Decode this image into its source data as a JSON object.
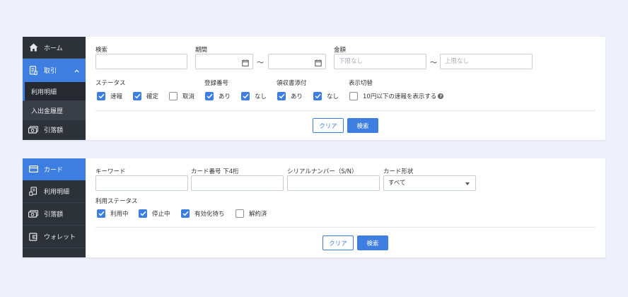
{
  "sidebar1": {
    "items": [
      {
        "label": "ホーム",
        "icon": "home-icon"
      },
      {
        "label": "取引",
        "icon": "receipt-icon",
        "active": true
      },
      {
        "label": "利用明細",
        "sub": true,
        "current": true
      },
      {
        "label": "入出金履歴",
        "sub": true
      },
      {
        "label": "引落額",
        "icon": "money-icon"
      }
    ]
  },
  "filter1": {
    "search_label": "検索",
    "period_label": "期間",
    "period_tilde": "～",
    "amount_label": "金額",
    "amount_min_placeholder": "下限なし",
    "amount_tilde": "～",
    "amount_max_placeholder": "上限なし",
    "status_label": "ステータス",
    "status_options": [
      {
        "label": "速報",
        "checked": true
      },
      {
        "label": "確定",
        "checked": true
      },
      {
        "label": "取消",
        "checked": false
      }
    ],
    "registration_label": "登録番号",
    "registration_options": [
      {
        "label": "あり",
        "checked": true
      },
      {
        "label": "なし",
        "checked": true
      }
    ],
    "receipt_label": "領収書添付",
    "receipt_options": [
      {
        "label": "あり",
        "checked": true
      },
      {
        "label": "なし",
        "checked": true
      }
    ],
    "display_label": "表示切替",
    "display_option": {
      "label": "10円以下の速報を表示する",
      "checked": false
    },
    "help_glyph": "?",
    "clear_label": "クリア",
    "search_button_label": "検索"
  },
  "sidebar2": {
    "items": [
      {
        "label": "カード",
        "icon": "card-icon",
        "active": true
      },
      {
        "label": "利用明細",
        "icon": "statement-icon"
      },
      {
        "label": "引落額",
        "icon": "money-icon"
      },
      {
        "label": "ウォレット",
        "icon": "wallet-icon"
      }
    ]
  },
  "filter2": {
    "keyword_label": "キーワード",
    "card_number_label": "カード番号 下4桁",
    "serial_label": "シリアルナンバー（S/N）",
    "card_type_label": "カード形状",
    "card_type_value": "すべて",
    "usage_status_label": "利用ステータス",
    "usage_status_options": [
      {
        "label": "利用中",
        "checked": true
      },
      {
        "label": "停止中",
        "checked": true
      },
      {
        "label": "有効化待ち",
        "checked": true
      },
      {
        "label": "解約済",
        "checked": false
      }
    ],
    "clear_label": "クリア",
    "search_button_label": "検索"
  },
  "colors": {
    "accent": "#3e7ee0",
    "sidebar_bg": "#2d3239",
    "page_bg": "#eef1fb"
  }
}
